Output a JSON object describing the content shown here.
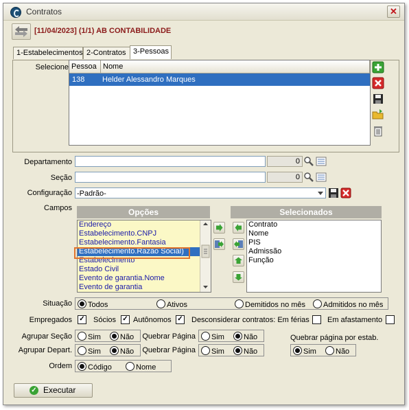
{
  "window": {
    "title": "Contratos",
    "close_glyph": "✕"
  },
  "toolbar": {
    "header": "[11/04/2023] (1/1) AB CONTABILIDADE"
  },
  "tabs": [
    {
      "label": "1-Estabelecimentos",
      "active": false
    },
    {
      "label": "2-Contratos",
      "active": false
    },
    {
      "label": "3-Pessoas",
      "active": true
    }
  ],
  "pessoas": {
    "label": "Selecione",
    "columns": [
      "Pessoa",
      "Nome"
    ],
    "rows": [
      {
        "pessoa": "138",
        "nome": "Helder Alessandro Marques",
        "selected": true
      }
    ]
  },
  "departamento": {
    "label": "Departamento",
    "value": "",
    "number": "0"
  },
  "secao": {
    "label": "Seção",
    "value": "",
    "number": "0"
  },
  "configuracao": {
    "label": "Configuração",
    "value": "-Padrão-"
  },
  "campos": {
    "label": "Campos",
    "opcoes_title": "Opções",
    "selecionados_title": "Selecionados",
    "opcoes": [
      "Endereço",
      "Estabelecimento.CNPJ",
      "Estabelecimento.Fantasia",
      "Estabelecimento.Razão Social)",
      "Estabelecimento",
      "Estado Civil",
      "Evento de garantia.Nome",
      "Evento de garantia"
    ],
    "selected_option": "Estabelecimento.Razão Social)",
    "selecionados": [
      "Contrato",
      "Nome",
      "PIS",
      "Admissão",
      "Função"
    ]
  },
  "situacao": {
    "label": "Situação",
    "options": [
      "Todos",
      "Ativos",
      "Demitidos no mês",
      "Admitidos no mês"
    ],
    "selected": "Todos"
  },
  "empregados": {
    "label": "Empregados",
    "socios": {
      "label": "Sócios",
      "checked": true
    },
    "autonomos": {
      "label": "Autônomos",
      "checked": true
    },
    "desconsiderar": {
      "label": "Desconsiderar contratos: Em férias",
      "checked": false
    },
    "afastamento": {
      "label": "Em afastamento",
      "checked": false
    },
    "empregados_checked": true
  },
  "agrupar_secao": {
    "label": "Agrupar Seção",
    "sim": "Sim",
    "nao": "Não",
    "selected": "Não"
  },
  "quebrar_pagina_1": {
    "label": "Quebrar Página",
    "sim": "Sim",
    "nao": "Não",
    "selected": "Não"
  },
  "agrupar_depart": {
    "label": "Agrupar Depart.",
    "sim": "Sim",
    "nao": "Não",
    "selected": "Não"
  },
  "quebrar_pagina_2": {
    "label": "Quebrar Página",
    "sim": "Sim",
    "nao": "Não",
    "selected": "Não"
  },
  "quebrar_estab": {
    "label": "Quebrar página por estab.",
    "sim": "Sim",
    "nao": "Não",
    "selected": "Sim"
  },
  "ordem": {
    "label": "Ordem",
    "options": [
      "Código",
      "Nome"
    ],
    "selected": "Código"
  },
  "executar": {
    "label": "Executar"
  }
}
